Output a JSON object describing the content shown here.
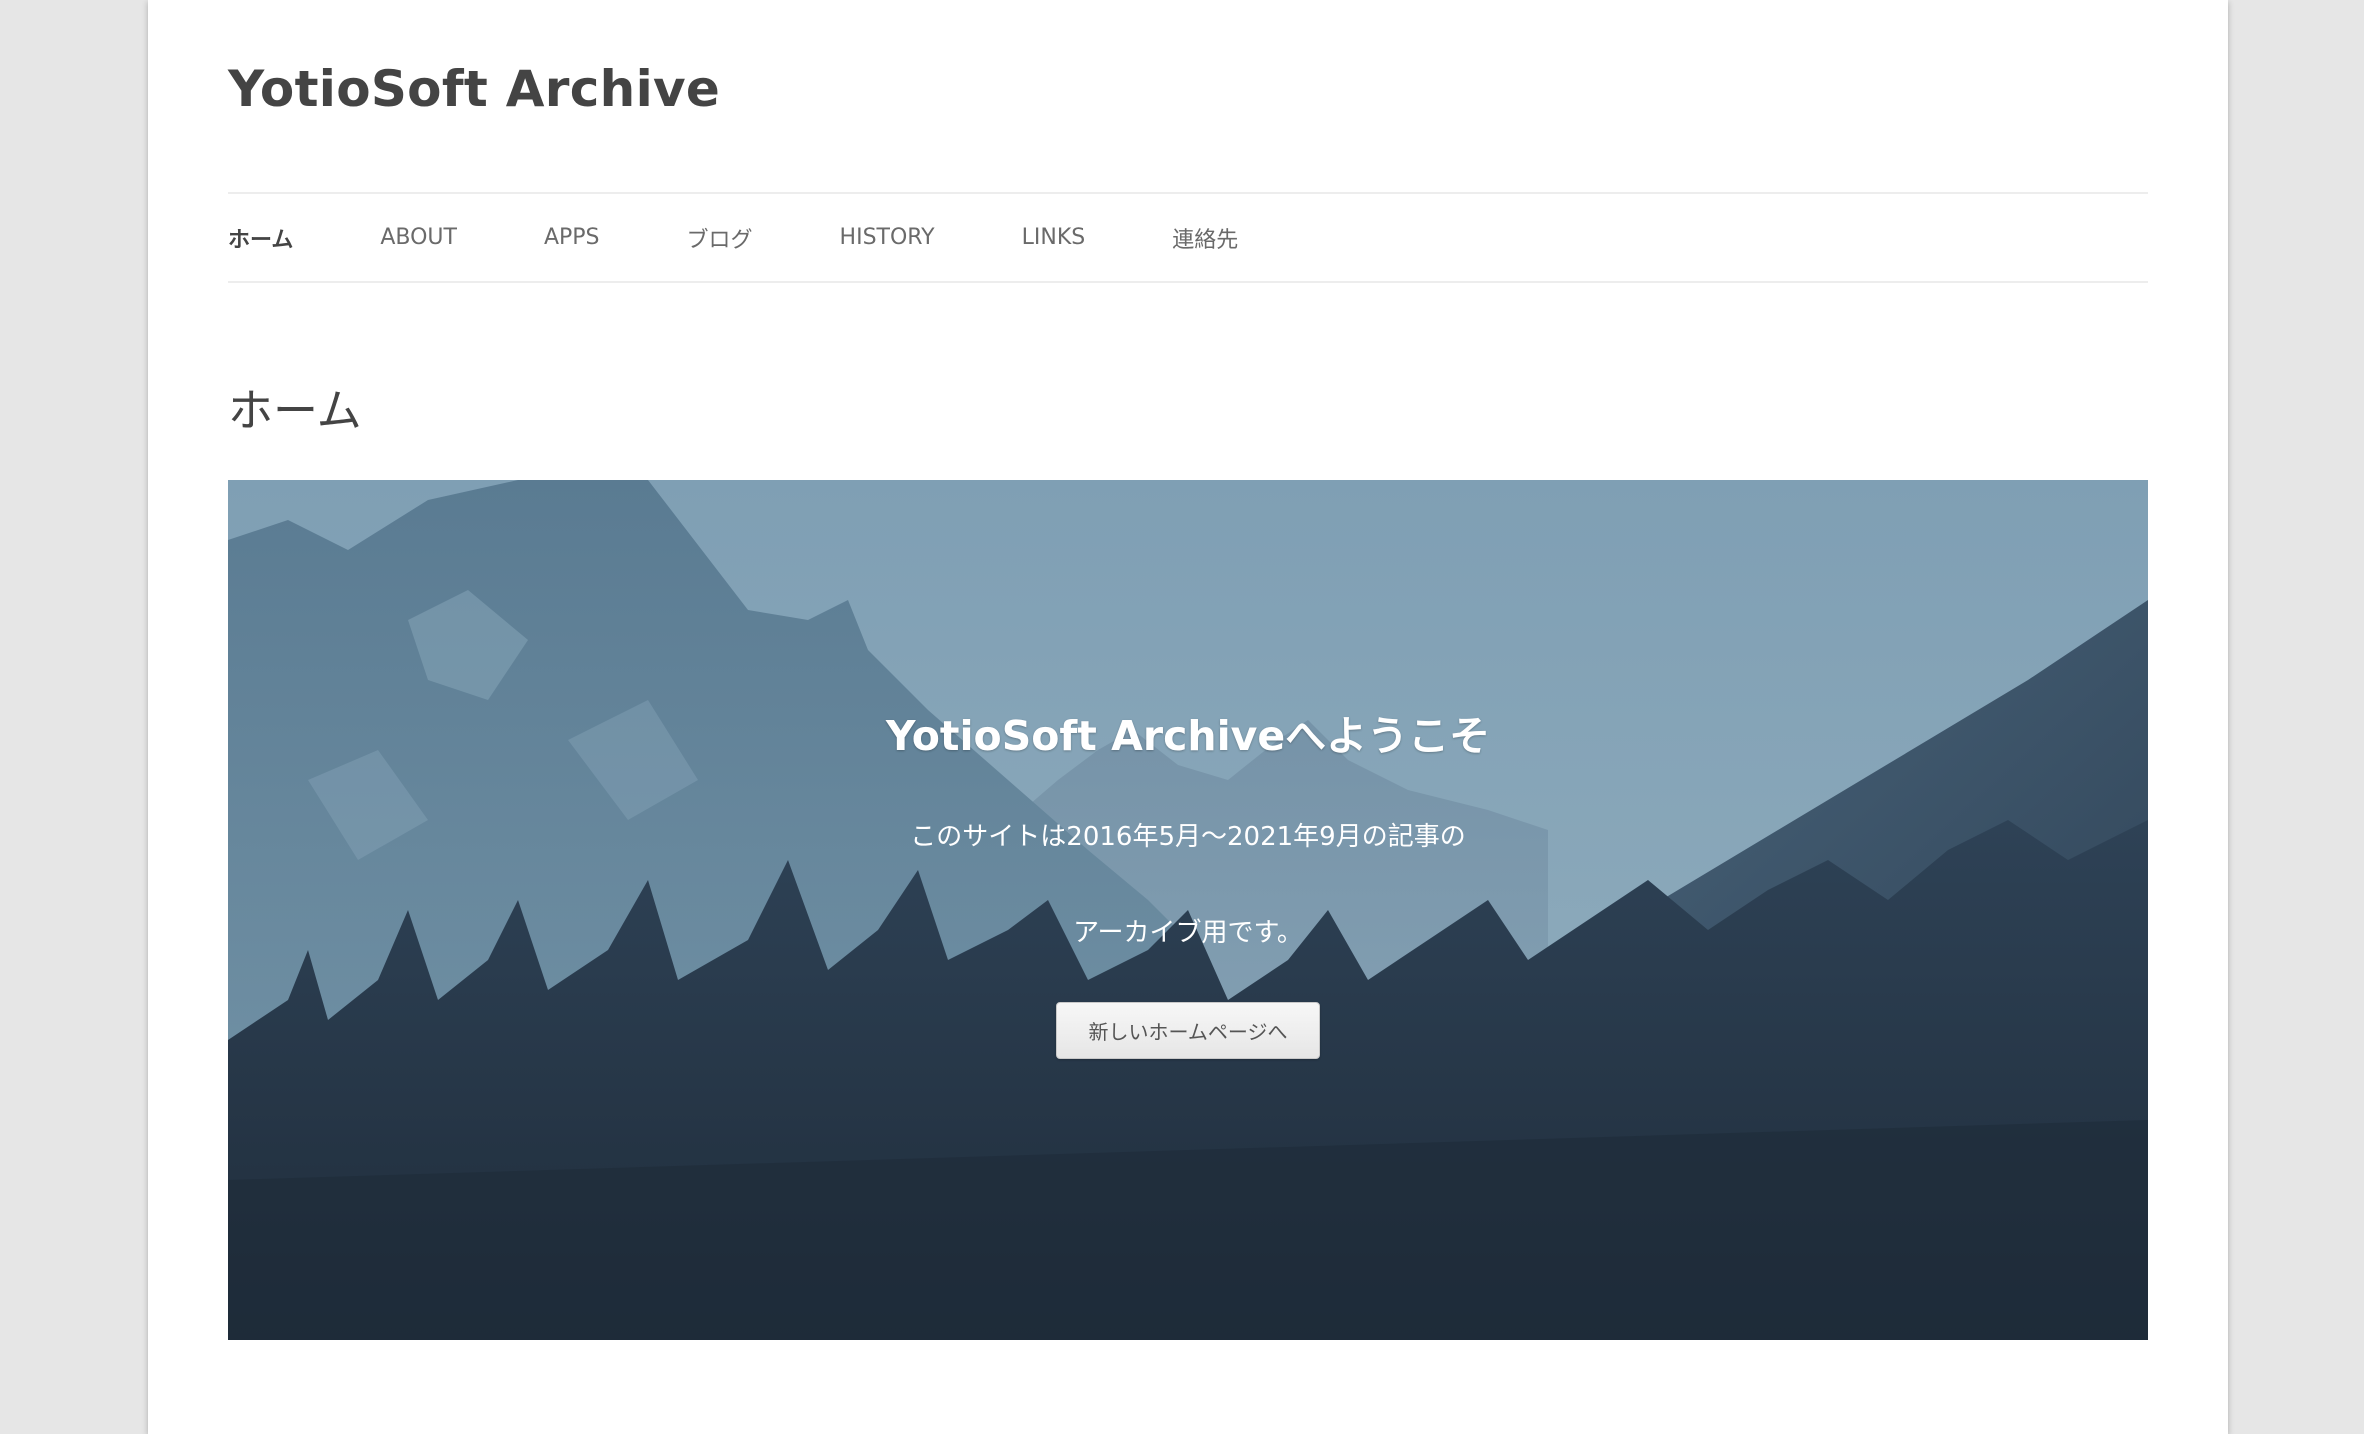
{
  "site": {
    "title": "YotioSoft Archive"
  },
  "nav": {
    "items": [
      {
        "label": "ホーム",
        "current": true
      },
      {
        "label": "ABOUT",
        "current": false
      },
      {
        "label": "APPS",
        "current": false
      },
      {
        "label": "ブログ",
        "current": false
      },
      {
        "label": "HISTORY",
        "current": false
      },
      {
        "label": "LINKS",
        "current": false
      },
      {
        "label": "連絡先",
        "current": false
      }
    ]
  },
  "page": {
    "title": "ホーム"
  },
  "hero": {
    "heading": "YotioSoft Archiveへようこそ",
    "line1": "このサイトは2016年5月〜2021年9月の記事の",
    "line2": "アーカイブ用です。",
    "button_label": "新しいホームページへ",
    "image": "mountain-forest-landscape"
  },
  "colors": {
    "page_background": "#e6e6e6",
    "content_background": "#ffffff",
    "text": "#444444",
    "nav_text": "#6a6a6a",
    "sky": "#86a5b8",
    "forest": "#27384a"
  }
}
